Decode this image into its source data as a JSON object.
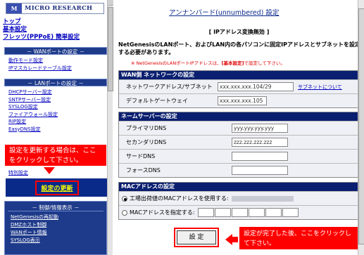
{
  "sidebar": {
    "logo_mark": "M",
    "logo_text": "MICRO RESEARCH",
    "top_links": [
      "トップ",
      "基本設定",
      "フレッツ(PPPoE) 簡単設定"
    ],
    "wan_header": "－ WANポートの設定 －",
    "wan_links": [
      "動作モード設定",
      "IPマスカレードテーブル設定"
    ],
    "lan_header": "－ LANポートの設定 －",
    "lan_links": [
      "DHCPサーバー設定",
      "SNTPサーバー設定",
      "SYSLOG設定",
      "ファイアウォール設定",
      "RIP設定",
      "EasyDNS設定"
    ],
    "callout": "設定を更新する場合は、ここをクリックして下さい。",
    "hidden_link": "特別設定",
    "update_button": "設定の更新",
    "lower_header": "－ 制御/情報表示 －",
    "lower_links": [
      "NetGenesisの再起動",
      "DMZホスト制御",
      "WANポート情報",
      "SYSLOG表示"
    ]
  },
  "main": {
    "title": "アンナンバード(unnumbered) 設定",
    "subtitle": "[ IPアドレス変換無効 ]",
    "description": "NetGenesisのLANポート、およびLAN内の各パソコンに固定IPアドレスとサブネットを設定する必要があります。",
    "note_prefix": "※ NetGenesisのLANポートIPアドレスは、",
    "note_bold": "[基本設定]",
    "note_suffix": "で設定して下さい。",
    "wan_section": {
      "header": "WAN側 ネットワークの設定",
      "network_label": "ネットワークアドレス/サブネット",
      "network_value": "xxx.xxx.xxx.104/29",
      "subnet_link": "サブネットについて",
      "gateway_label": "デフォルトゲートウェイ",
      "gateway_value": "xxx.xxx.xxx.105"
    },
    "dns_section": {
      "header": "ネームサーバーの設定",
      "primary_label": "プライマリDNS",
      "primary_value": "yyy.yyy.yyy.yyy",
      "secondary_label": "セカンダリDNS",
      "secondary_value": "zzz.zzz.zzz.zzz",
      "third_label": "サードDNS",
      "fourth_label": "フォースDNS"
    },
    "mac_section": {
      "header": "MACアドレスの設定",
      "factory_label": "工場出荷値のMACアドレスを使用する:",
      "custom_label": "MACアドレスを指定する:"
    },
    "set_button": "設 定",
    "callout": "設定が完了した後、ここをクリックして下さい。"
  }
}
